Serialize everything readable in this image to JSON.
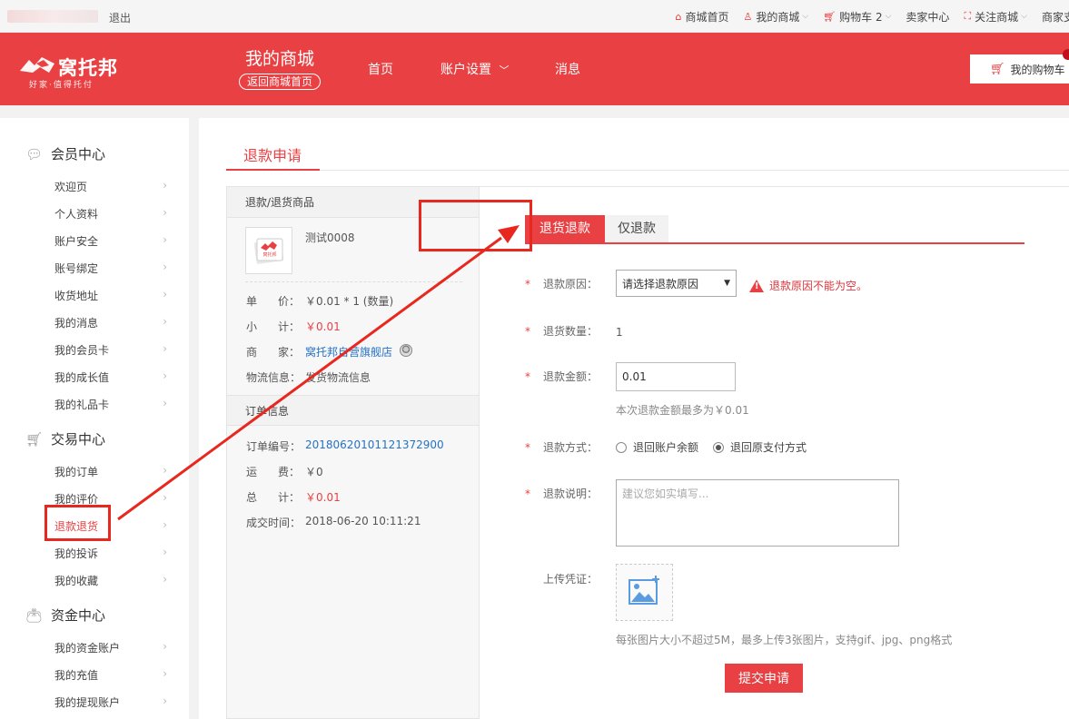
{
  "topbar": {
    "logout": "退出",
    "links": [
      {
        "label": "商城首页",
        "icon": "home-icon",
        "chevron": false
      },
      {
        "label": "我的商城",
        "icon": "user-icon",
        "chevron": true
      },
      {
        "label": "购物车 2",
        "icon": "cart-icon",
        "chevron": true
      },
      {
        "label": "卖家中心",
        "icon": "",
        "chevron": false
      },
      {
        "label": "关注商城",
        "icon": "qr-icon",
        "chevron": true
      },
      {
        "label": "商家支",
        "icon": "",
        "chevron": false
      }
    ]
  },
  "header": {
    "logo_name": "窝托邦",
    "logo_slogan": "好家·值得托付",
    "mall_title": "我的商城",
    "back_link": "返回商城首页",
    "nav": [
      "首页",
      "账户设置",
      "消息"
    ],
    "cart_button": "我的购物车"
  },
  "sidebar": {
    "sections": [
      {
        "title": "会员中心",
        "icon": "chat-icon",
        "items": [
          "欢迎页",
          "个人资料",
          "账户安全",
          "账号绑定",
          "收货地址",
          "我的消息",
          "我的会员卡",
          "我的成长值",
          "我的礼品卡"
        ]
      },
      {
        "title": "交易中心",
        "icon": "cart-icon",
        "items": [
          "我的订单",
          "我的评价",
          "退款退货",
          "我的投诉",
          "我的收藏"
        ]
      },
      {
        "title": "资金中心",
        "icon": "money-bag-icon",
        "items": [
          "我的资金账户",
          "我的充值",
          "我的提现账户"
        ]
      }
    ],
    "active_item": "退款退货"
  },
  "page": {
    "title": "退款申请"
  },
  "goods": {
    "header": "退款/退货商品",
    "thumb_logo": "窝托邦",
    "product_name": "测试0008",
    "unit_price_label": [
      "单",
      "价："
    ],
    "unit_price": "￥0.01 * 1 (数量)",
    "subtotal_label": [
      "小",
      "计："
    ],
    "subtotal": "￥0.01",
    "merchant_label": [
      "商",
      "家："
    ],
    "merchant": "窝托邦自营旗舰店",
    "logistics_label": "物流信息：",
    "logistics": "发货物流信息"
  },
  "order": {
    "header": "订单信息",
    "number_label": "订单编号：",
    "number": "20180620101121372900",
    "freight_label": [
      "运",
      "费："
    ],
    "freight": "￥0",
    "total_label": [
      "总",
      "计："
    ],
    "total": "￥0.01",
    "time_label": "成交时间：",
    "time": "2018-06-20 10:11:21"
  },
  "form": {
    "tabs": [
      "退货退款",
      "仅退款"
    ],
    "active_tab": "退货退款",
    "reason_label": "退款原因：",
    "reason_value": "请选择退款原因",
    "reason_error": "退款原因不能为空。",
    "qty_label": "退货数量：",
    "qty_value": "1",
    "amount_label": "退款金额：",
    "amount_value": "0.01",
    "amount_hint": "本次退款金额最多为￥0.01",
    "method_label": "退款方式：",
    "method_options": [
      "退回账户余额",
      "退回原支付方式"
    ],
    "method_selected": "退回原支付方式",
    "desc_label": "退款说明：",
    "desc_placeholder": "建议您如实填写...",
    "upload_label": "上传凭证：",
    "upload_hint": "每张图片大小不超过5M，最多上传3张图片，支持gif、jpg、png格式",
    "submit": "提交申请"
  },
  "colors": {
    "brand_red": "#e94143",
    "annotation_red": "#e8271f",
    "link_blue": "#2572c6"
  }
}
